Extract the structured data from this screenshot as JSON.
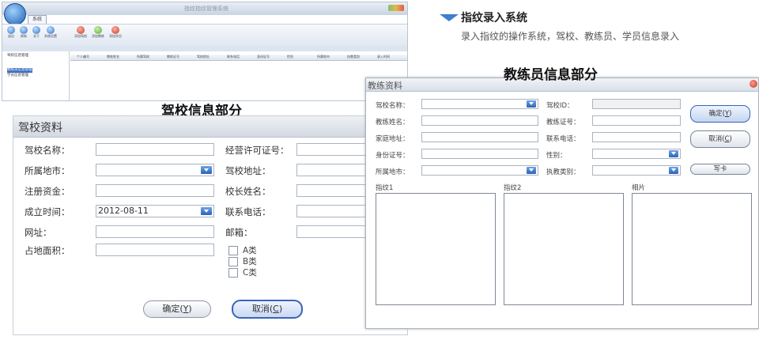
{
  "app": {
    "title": "指纹指纹管理系统",
    "tab": "系统",
    "ribbon_buttons": [
      {
        "label": "退出",
        "color": "#2f6fc8"
      },
      {
        "label": "刷新",
        "color": "#2f6fc8"
      },
      {
        "label": "关于",
        "color": "#2f6fc8"
      },
      {
        "label": "系统设置",
        "color": "#2f6fc8"
      },
      {
        "label": "添加驾校",
        "color": "#c83a2a"
      },
      {
        "label": "添加教练",
        "color": "#5aa832"
      },
      {
        "label": "添加学员",
        "color": "#c83a2a"
      }
    ],
    "tree": [
      "驾校信息管理",
      "教练员信息管理",
      "学员信息管理"
    ],
    "grid_columns": [
      "个人编号",
      "教练姓名",
      "所属驾校",
      "教练证号",
      "驾校地址",
      "联系电话",
      "身份证号",
      "性别",
      "所属地市",
      "执教类别",
      "录入时间"
    ]
  },
  "header": {
    "title": "指纹录入系统",
    "subtitle": "录入指纹的操作系统，驾校、教练员、学员信息录入"
  },
  "captions": {
    "school": "驾校信息部分",
    "coach": "教练员信息部分"
  },
  "school_form": {
    "title": "驾校资料",
    "fields": {
      "name": {
        "label": "驾校名称：",
        "value": ""
      },
      "city": {
        "label": "所属地市：",
        "value": ""
      },
      "capital": {
        "label": "注册资金：",
        "value": ""
      },
      "founded": {
        "label": "成立时间：",
        "value": "2012-08-11"
      },
      "website": {
        "label": "网址：",
        "value": ""
      },
      "area": {
        "label": "占地面积：",
        "value": ""
      },
      "license": {
        "label": "经营许可证号：",
        "value": ""
      },
      "address": {
        "label": "驾校地址：",
        "value": ""
      },
      "principal": {
        "label": "校长姓名：",
        "value": ""
      },
      "phone": {
        "label": "联系电话：",
        "value": ""
      },
      "email": {
        "label": "邮箱：",
        "value": ""
      }
    },
    "categories": [
      "A类",
      "B类",
      "C类"
    ],
    "ok_label": "确定(",
    "ok_key": "Y",
    "cancel_label": "取消(",
    "cancel_key": "C",
    "close_paren": ")"
  },
  "coach_form": {
    "title": "教练资料",
    "fields": {
      "school": {
        "label": "驾校名称：",
        "value": ""
      },
      "coach_name": {
        "label": "教练姓名：",
        "value": ""
      },
      "home": {
        "label": "家庭地址：",
        "value": ""
      },
      "idcard": {
        "label": "身份证号：",
        "value": ""
      },
      "city": {
        "label": "所属地市：",
        "value": ""
      },
      "school_id": {
        "label": "驾校ID：",
        "value": ""
      },
      "coach_cert": {
        "label": "教练证号：",
        "value": ""
      },
      "phone": {
        "label": "联系电话：",
        "value": ""
      },
      "gender": {
        "label": "性别：",
        "value": ""
      },
      "category": {
        "label": "执教类别：",
        "value": ""
      }
    },
    "fingerprint1": "指纹1",
    "fingerprint2": "指纹2",
    "photo": "相片",
    "ok_label": "确定(",
    "ok_key": "Y",
    "cancel_label": "取消(",
    "cancel_key": "C",
    "close_paren": ")",
    "write_card": "写卡"
  }
}
